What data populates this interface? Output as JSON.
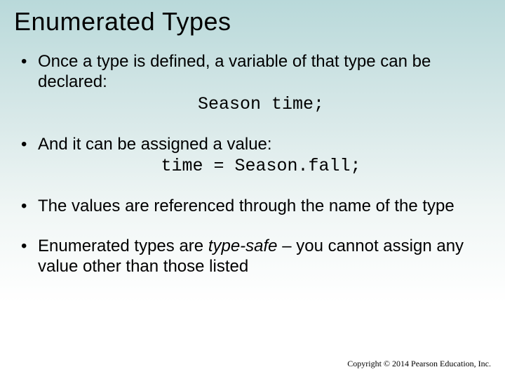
{
  "title": "Enumerated Types",
  "bullets": {
    "b1_text": "Once a type is defined, a variable of that type can be declared:",
    "b1_code": "Season time;",
    "b2_text": "And it can be assigned a value:",
    "b2_code": "time = Season.fall;",
    "b3_text": "The values are referenced through the name of the type",
    "b4_pre": "Enumerated types are ",
    "b4_em": "type-safe",
    "b4_post": " – you cannot assign any value other than those listed"
  },
  "footer": "Copyright © 2014 Pearson Education, Inc."
}
